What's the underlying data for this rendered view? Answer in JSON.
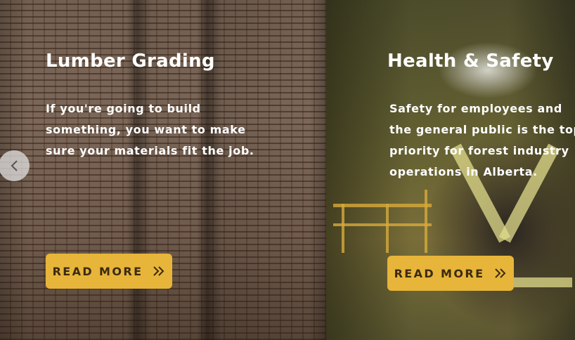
{
  "cards": [
    {
      "title": "Lumber Grading",
      "text": "If you're going to build something, you want to make sure your materials fit the job.",
      "button_label": "READ MORE"
    },
    {
      "title": "Health & Safety",
      "text": "Safety for employees and the general public is the top priority for forest industry operations in Alberta.",
      "button_label": "READ MORE"
    }
  ],
  "icons": {
    "prev": "chevron-left-icon",
    "read_more": "double-chevron-right-icon"
  },
  "colors": {
    "button": "#e7b53a",
    "button_text": "#3b2a10",
    "text": "#ffffff"
  }
}
